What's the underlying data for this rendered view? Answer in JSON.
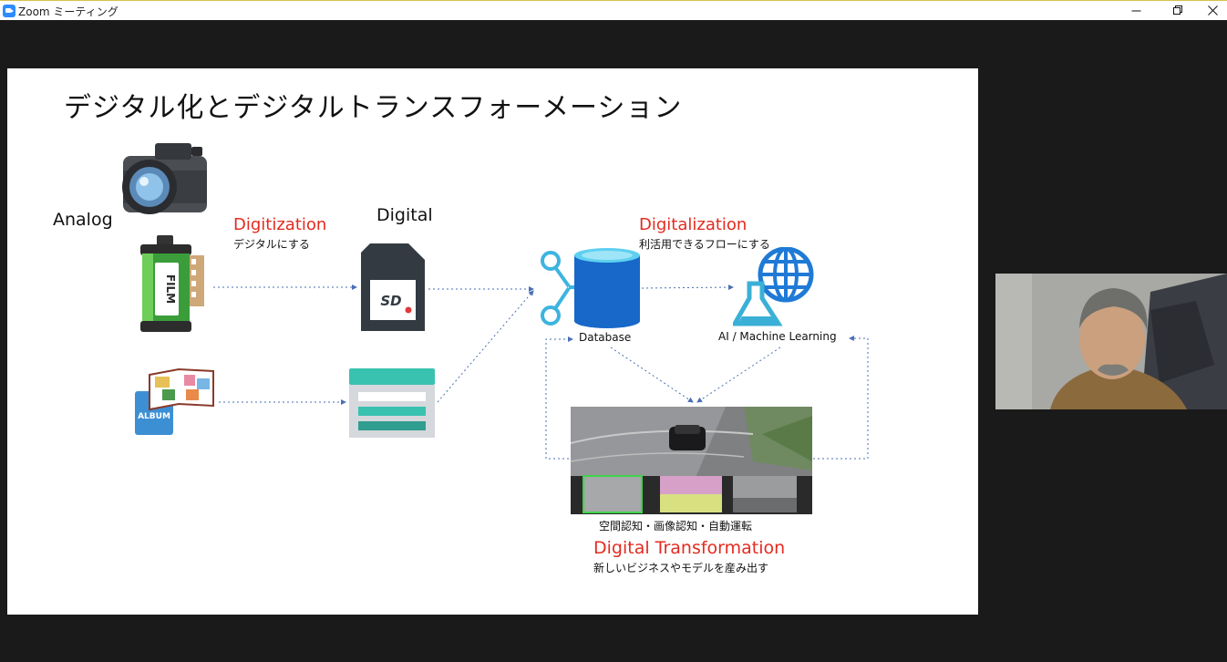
{
  "window": {
    "title": "Zoom ミーティング",
    "minimize_icon": "minimize-icon",
    "restore_icon": "restore-icon",
    "close_icon": "close-icon"
  },
  "slide": {
    "title": "デジタル化とデジタルトランスフォーメーション",
    "analog_label": "Analog",
    "digital_label": "Digital",
    "digitization": "Digitization",
    "digitization_sub": "デジタルにする",
    "digitalization": "Digitalization",
    "digitalization_sub": "利活用できるフローにする",
    "database_label": "Database",
    "ai_label": "AI / Machine Learning",
    "video_caption": "空間認知・画像認知・自動運転",
    "dx": "Digital Transformation",
    "dx_sub": "新しいビジネスやモデルを産み出す",
    "film_text": "FILM",
    "album_text": "ALBUM",
    "sd_text": "SD"
  },
  "colors": {
    "accent_red": "#e32b20",
    "arrow_blue": "#4a6fb5",
    "zoom_blue": "#2d8cff"
  }
}
